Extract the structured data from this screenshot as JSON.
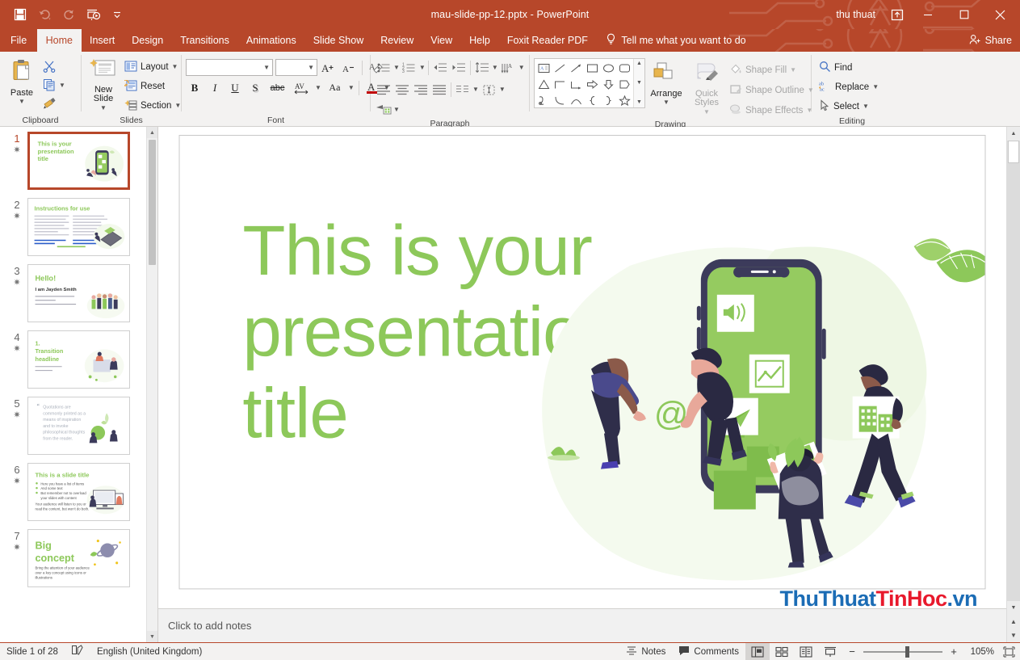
{
  "titlebar": {
    "document_title": "mau-slide-pp-12.pptx  -  PowerPoint",
    "user_name": "thu thuat",
    "qat": [
      {
        "name": "save-icon",
        "label": "Save"
      },
      {
        "name": "undo-icon",
        "label": "Undo"
      },
      {
        "name": "redo-icon",
        "label": "Repeat"
      },
      {
        "name": "start-from-beginning-icon",
        "label": "Start From Beginning"
      },
      {
        "name": "customize-quick-access-toolbar-icon",
        "label": "Customize Quick Access Toolbar"
      }
    ],
    "ribbon_display_options": "Ribbon Display Options",
    "minimize": "Minimize",
    "restore": "Restore Down",
    "close": "Close"
  },
  "tabs": [
    {
      "label": "File",
      "active": false
    },
    {
      "label": "Home",
      "active": true
    },
    {
      "label": "Insert",
      "active": false
    },
    {
      "label": "Design",
      "active": false
    },
    {
      "label": "Transitions",
      "active": false
    },
    {
      "label": "Animations",
      "active": false
    },
    {
      "label": "Slide Show",
      "active": false
    },
    {
      "label": "Review",
      "active": false
    },
    {
      "label": "View",
      "active": false
    },
    {
      "label": "Help",
      "active": false
    },
    {
      "label": "Foxit Reader PDF",
      "active": false
    }
  ],
  "tellme": {
    "placeholder": "Tell me what you want to do"
  },
  "share": {
    "label": "Share"
  },
  "ribbon": {
    "clipboard": {
      "label": "Clipboard",
      "paste": "Paste",
      "cut": "Cut",
      "copy": "Copy",
      "format_painter": "Format Painter"
    },
    "slides": {
      "label": "Slides",
      "new_slide": "New\nSlide",
      "new_slide_line1": "New",
      "new_slide_line2": "Slide",
      "layout": "Layout",
      "reset": "Reset",
      "section": "Section"
    },
    "font": {
      "label": "Font",
      "font_name_value": "",
      "font_size_value": "",
      "increase_font": "A",
      "decrease_font": "A",
      "clear_formatting": "Clear All Formatting",
      "bold": "B",
      "italic": "I",
      "underline": "U",
      "shadow": "S",
      "strikethrough": "abc",
      "character_spacing": "AV",
      "change_case": "Aa",
      "font_color": "A"
    },
    "paragraph": {
      "label": "Paragraph",
      "bullets": "Bullets",
      "numbering": "Numbering",
      "decrease_indent": "Decrease List Level",
      "increase_indent": "Increase List Level",
      "line_spacing": "Line Spacing",
      "text_direction": "Text Direction",
      "align_text": "Align Text",
      "convert_to_smartart": "Convert to SmartArt",
      "align_left": "Align Left",
      "center": "Center",
      "align_right": "Align Right",
      "justify": "Justify",
      "columns": "Columns"
    },
    "drawing": {
      "label": "Drawing",
      "arrange": "Arrange",
      "quick_styles_line1": "Quick",
      "quick_styles_line2": "Styles",
      "shape_fill": "Shape Fill",
      "shape_outline": "Shape Outline",
      "shape_effects": "Shape Effects"
    },
    "editing": {
      "label": "Editing",
      "find": "Find",
      "replace": "Replace",
      "select": "Select"
    }
  },
  "thumbnails": [
    {
      "number": "1",
      "selected": true,
      "kind": "title",
      "title": "This is your presentation title"
    },
    {
      "number": "2",
      "selected": false,
      "kind": "instructions",
      "title": "Instructions for use"
    },
    {
      "number": "3",
      "selected": false,
      "kind": "hello",
      "title": "Hello!",
      "subtitle": "I am Jayden Smith"
    },
    {
      "number": "4",
      "selected": false,
      "kind": "transition",
      "title": "1. Transition headline"
    },
    {
      "number": "5",
      "selected": false,
      "kind": "quote",
      "title": "Quotations are commonly printed as a means of inspiration and to invoke philosophical thoughts from the reader."
    },
    {
      "number": "6",
      "selected": false,
      "kind": "slidetitle",
      "title": "This is a slide title"
    },
    {
      "number": "7",
      "selected": false,
      "kind": "bigconcept",
      "title": "Big concept"
    }
  ],
  "slide": {
    "title": "This is your presentation title",
    "title_color": "#8DC85A",
    "art": {
      "phone_frame_color": "#3C3B5B",
      "phone_screen_color": "#95CB60",
      "accent_green": "#8DC85A",
      "at_symbol": "@",
      "cards": [
        "megaphone-icon",
        "chart-icon",
        "paper-plane-icon",
        "document-icon",
        "building-icon"
      ]
    }
  },
  "notes": {
    "placeholder": "Click to add notes"
  },
  "watermark": {
    "part1": "ThuThuat",
    "part2": "TinHoc",
    "part3": ".vn",
    "blue": "#1B6CB5",
    "red": "#E8192C"
  },
  "statusbar": {
    "slide_count": "Slide 1 of 28",
    "language": "English (United Kingdom)",
    "notes_button": "Notes",
    "comments_button": "Comments",
    "views": [
      {
        "name": "normal-view",
        "active": true
      },
      {
        "name": "slide-sorter-view",
        "active": false
      },
      {
        "name": "reading-view",
        "active": false
      },
      {
        "name": "slide-show-view",
        "active": false
      }
    ],
    "zoom_out": "−",
    "zoom_in": "+",
    "zoom_level": "105%",
    "fit_to_window": "Fit slide to current window"
  }
}
